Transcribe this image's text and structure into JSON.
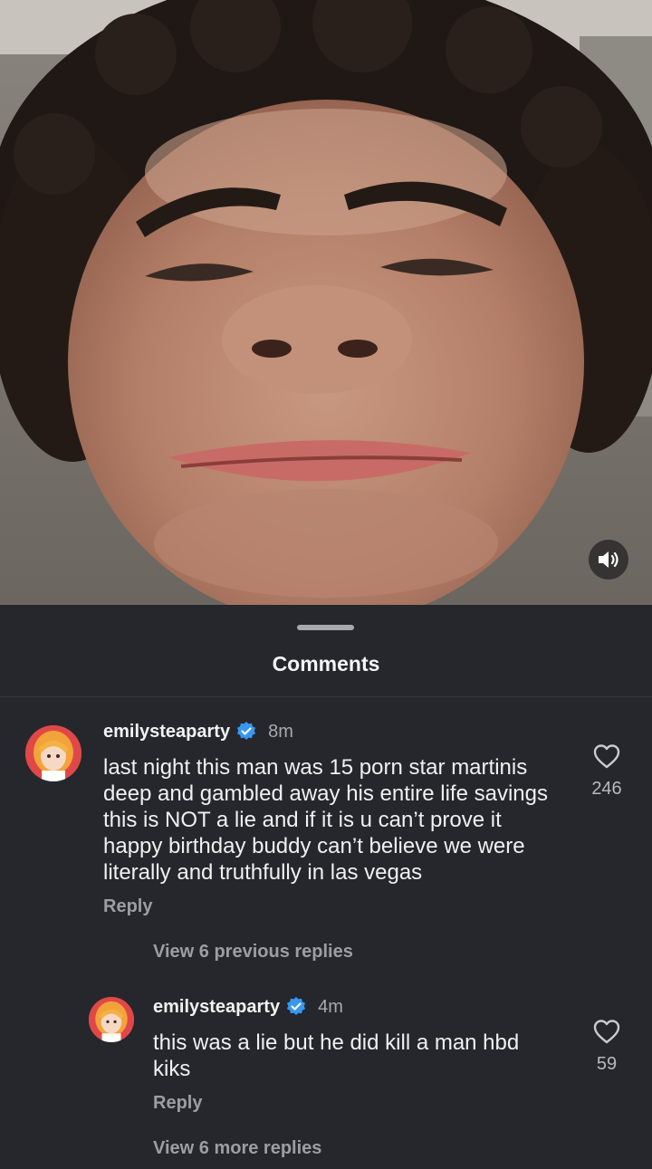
{
  "media": {
    "description_icon": "speaker-icon"
  },
  "sheet": {
    "title": "Comments"
  },
  "comments": [
    {
      "username": "emilysteaparty",
      "verified": true,
      "time": "8m",
      "text": "last night this man was 15 porn star martinis deep and gambled away his entire life savings this is NOT a lie and if it is u can’t prove it happy birthday buddy can’t believe we were literally and truthfully in las vegas",
      "reply_label": "Reply",
      "likes": "246",
      "view_replies_label": "View 6 previous replies"
    },
    {
      "username": "emilysteaparty",
      "verified": true,
      "time": "4m",
      "text": "this was a lie but he did kill a man hbd kiks",
      "reply_label": "Reply",
      "likes": "59",
      "view_replies_label": "View 6 more replies"
    }
  ],
  "colors": {
    "background": "#25272c",
    "verified_badge": "#3897f0",
    "muted_text": "#9c9ea3"
  }
}
